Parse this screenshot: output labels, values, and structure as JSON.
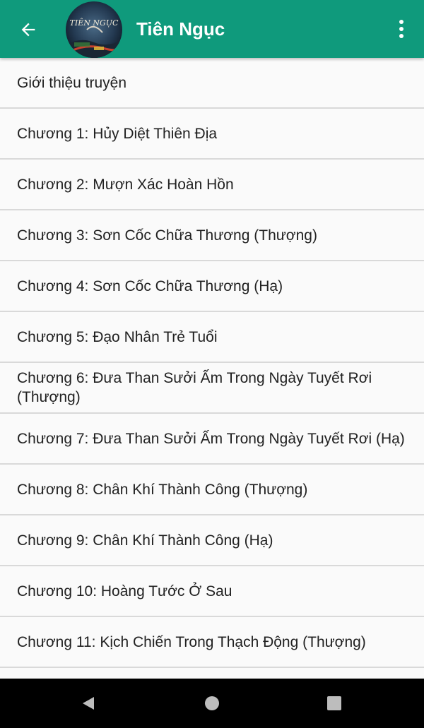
{
  "toolbar": {
    "title": "Tiên Ngục",
    "cover_text": "TIÊN NGỤC",
    "back_icon": "arrow-left-icon",
    "menu_icon": "more-vertical-icon",
    "accent_color": "#0f9a7c"
  },
  "chapters": [
    "Giới thiệu truyện",
    "Chương 1: Hủy Diệt Thiên Địa",
    "Chương 2: Mượn Xác Hoàn Hồn",
    "Chương 3: Sơn Cốc Chữa Thương (Thượng)",
    "Chương 4: Sơn Cốc Chữa Thương (Hạ)",
    "Chương 5: Đạo Nhân Trẻ Tuổi",
    "Chương 6: Đưa Than Sưởi Ấm Trong Ngày Tuyết Rơi (Thượng)",
    "Chương 7: Đưa Than Sưởi Ấm Trong Ngày Tuyết Rơi (Hạ)",
    "Chương 8: Chân Khí Thành Công (Thượng)",
    "Chương 9: Chân Khí Thành Công (Hạ)",
    "Chương 10: Hoàng Tước Ở Sau",
    "Chương 11: Kịch Chiến Trong Thạch Động (Thượng)"
  ],
  "navbar": {
    "back_icon": "nav-back-triangle-icon",
    "home_icon": "nav-home-circle-icon",
    "recents_icon": "nav-recents-square-icon"
  }
}
